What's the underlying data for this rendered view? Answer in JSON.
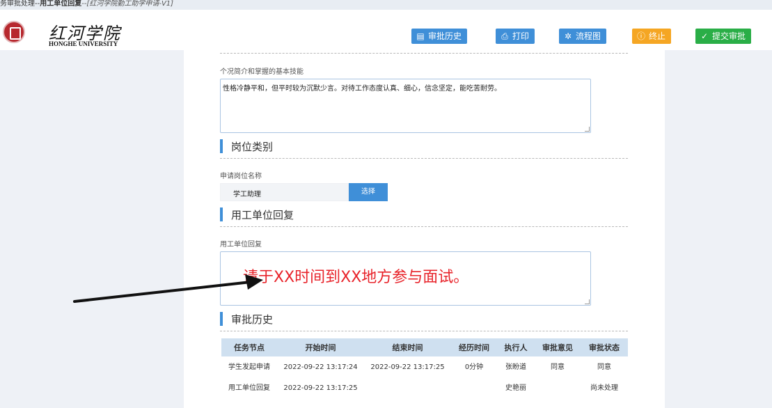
{
  "window_title": {
    "prefix": "务审批处理--",
    "main": "用工单位回复",
    "suffix": "--[红河学院勤工助学申请-V1]"
  },
  "logo": {
    "cn": "红河学院",
    "en": "HONGHE UNIVERSITY"
  },
  "toolbar": {
    "history": "审批历史",
    "print": "打印",
    "flowchart": "流程图",
    "terminate": "终止",
    "submit": "提交审批"
  },
  "form": {
    "intro_label": "个况简介和掌握的基本技能",
    "intro_value": "性格冷静平和，但平时较为沉默少言。对待工作态度认真、细心，信念坚定，能吃苦耐劳。",
    "section_position": "岗位类别",
    "position_label": "申请岗位名称",
    "position_value": "学工助理",
    "select_label": "选择",
    "section_reply": "用工单位回复",
    "reply_label": "用工单位回复",
    "reply_value": "请于XX时间到XX地方参与面试。",
    "section_history": "审批历史"
  },
  "history_table": {
    "headers": [
      "任务节点",
      "开始时间",
      "结束时间",
      "经历时间",
      "执行人",
      "审批意见",
      "审批状态"
    ],
    "rows": [
      [
        "学生发起申请",
        "2022-09-22 13:17:24",
        "2022-09-22 13:17:25",
        "0分钟",
        "张盼道",
        "同意",
        "同意"
      ],
      [
        "用工单位回复",
        "2022-09-22 13:17:25",
        "",
        "",
        "史艳丽",
        "",
        "尚未处理"
      ]
    ]
  },
  "colors": {
    "accent_blue": "#3f8fd8",
    "terminate_orange": "#f5a623",
    "submit_green": "#2aae47",
    "reply_text_red": "#e8232a"
  }
}
